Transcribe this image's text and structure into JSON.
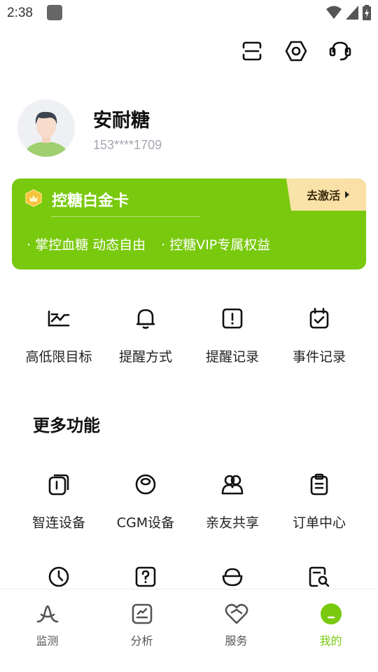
{
  "status_bar": {
    "time": "2:38"
  },
  "profile": {
    "name": "安耐糖",
    "phone": "153****1709"
  },
  "vip_card": {
    "title": "控糖白金卡",
    "activate_label": "去激活",
    "benefits": [
      "· 掌控血糖 动态自由",
      "· 控糖VIP专属权益"
    ],
    "accent_color": "#79c90e"
  },
  "quick_actions": [
    {
      "label": "高低限目标",
      "icon": "threshold-icon"
    },
    {
      "label": "提醒方式",
      "icon": "bell-icon"
    },
    {
      "label": "提醒记录",
      "icon": "alert-record-icon"
    },
    {
      "label": "事件记录",
      "icon": "calendar-check-icon"
    }
  ],
  "more_section": {
    "title": "更多功能",
    "items": [
      {
        "label": "智连设备",
        "icon": "smart-device-icon"
      },
      {
        "label": "CGM设备",
        "icon": "cgm-device-icon"
      },
      {
        "label": "亲友共享",
        "icon": "family-share-icon"
      },
      {
        "label": "订单中心",
        "icon": "clipboard-icon"
      }
    ],
    "more_icons": [
      "clock-icon",
      "help-icon",
      "food-bowl-icon",
      "search-report-icon"
    ]
  },
  "bottom_nav": [
    {
      "label": "监测",
      "icon": "monitor-icon",
      "active": false
    },
    {
      "label": "分析",
      "icon": "analysis-icon",
      "active": false
    },
    {
      "label": "服务",
      "icon": "service-icon",
      "active": false
    },
    {
      "label": "我的",
      "icon": "profile-icon",
      "active": true
    }
  ]
}
